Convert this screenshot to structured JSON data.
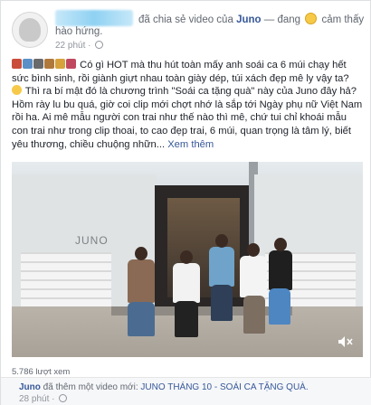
{
  "post": {
    "header_suffix": "đã chia sẻ video của",
    "page_name": "Juno",
    "feeling_prefix": "— đang",
    "feeling_text": "cảm thấy",
    "feeling_line2": "hào hứng.",
    "time": "22 phút",
    "meta_sep": "·",
    "emoji_prefix": [
      {
        "name": "high-heel-emoji",
        "color": "#c94d3a"
      },
      {
        "name": "shoe-emoji",
        "color": "#5b8fc7"
      },
      {
        "name": "sneaker-emoji",
        "color": "#6a6a6a"
      },
      {
        "name": "bag-emoji",
        "color": "#b0793c"
      },
      {
        "name": "handbag-emoji",
        "color": "#d7a23b"
      },
      {
        "name": "purse-emoji",
        "color": "#c0485e"
      }
    ],
    "text_line1": "Có gì HOT mà thu hút toàn mấy anh soái ca 6 múi chạy hết sức bình sinh, rồi giành giựt nhau toàn giày dép, túi xách đẹp mê ly vậy ta?",
    "text_line2_emoji": "point-emoji",
    "text_line2": "Thì ra bí mật đó là chương trình \"Soái ca tặng quà\" này của Juno đây hả? Hồm rày lu bu quá, giờ coi clip mới chợt nhớ là sắp tới Ngày phụ nữ Việt Nam rồi ha. Ai mê mẫu người con trai như thế nào thì mê, chứ tui chỉ khoái mẫu con trai như trong clip thoai, to cao đẹp trai, 6 múi, quan trọng là tâm lý, biết yêu thương, chiều chuộng nhữn...",
    "see_more": "Xem thêm"
  },
  "video": {
    "sign_text": "JUNO",
    "mute_icon": "speaker-mute-icon"
  },
  "stats": {
    "views": "5.786 lượt xem"
  },
  "shared": {
    "page_name": "Juno",
    "action": "đã thêm một video mới:",
    "video_title": "JUNO THÁNG 10 - SOÁI CA TẶNG QUÀ.",
    "time": "28 phút",
    "meta_sep": "·"
  },
  "colors": {
    "link": "#365899",
    "meta": "#90949c",
    "name_blur": "#8fd1f2"
  }
}
